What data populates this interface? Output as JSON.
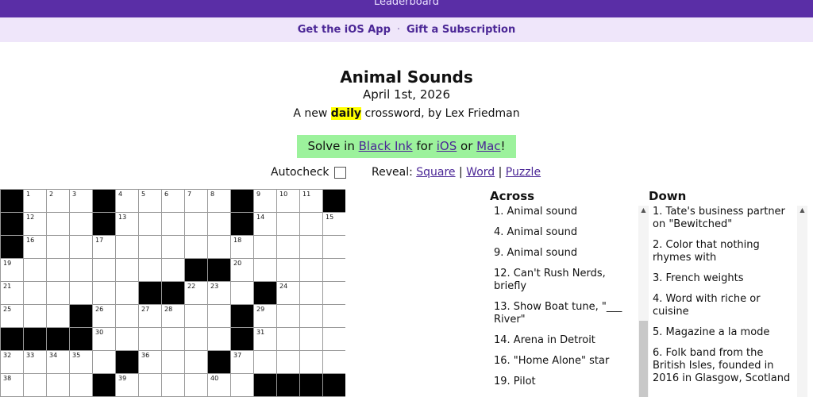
{
  "header": {
    "leaderboard_label": "Leaderboard"
  },
  "promo": {
    "ios_app": "Get the iOS App",
    "separator": "·",
    "gift": "Gift a Subscription"
  },
  "puzzle": {
    "title": "Animal Sounds",
    "date": "April 1st, 2026",
    "byline_pre": "A new ",
    "byline_highlight": "daily",
    "byline_post": " crossword, by Lex Friedman"
  },
  "solve_banner": {
    "prefix": "Solve in ",
    "app_link": "Black Ink",
    "mid": " for ",
    "ios_link": "iOS",
    "or": " or ",
    "mac_link": "Mac",
    "suffix": "!"
  },
  "controls": {
    "autocheck_label": "Autocheck",
    "reveal_label": "Reveal:",
    "square": "Square",
    "word": "Word",
    "puzzle": "Puzzle",
    "sep": "|"
  },
  "grid_rows": [
    [
      "#",
      "1",
      "2",
      "3",
      "#",
      "4",
      "5",
      "6",
      "7",
      "8",
      "#",
      "9",
      "10",
      "11",
      "#"
    ],
    [
      "#",
      "12",
      "",
      "",
      "#",
      "13",
      "",
      "",
      "",
      "",
      "#",
      "14",
      "",
      "",
      "15"
    ],
    [
      "#",
      "16",
      "",
      "",
      "17",
      "",
      "",
      "",
      "",
      "",
      "18",
      "",
      "",
      "",
      ""
    ],
    [
      "19",
      "",
      "",
      "",
      "",
      "",
      "",
      "",
      "#",
      "#",
      "20",
      "",
      "",
      "",
      ""
    ],
    [
      "21",
      "",
      "",
      "",
      "",
      "",
      "#",
      "#",
      "22",
      "23",
      "",
      "#",
      "24",
      "",
      ""
    ],
    [
      "25",
      "",
      "",
      "#",
      "26",
      "",
      "27",
      "28",
      "",
      "",
      "#",
      "29",
      "",
      "",
      ""
    ],
    [
      "#",
      "#",
      "#",
      "#",
      "30",
      "",
      "",
      "",
      "",
      "",
      "#",
      "31",
      "",
      "",
      ""
    ],
    [
      "32",
      "33",
      "34",
      "35",
      "",
      "#",
      "36",
      "",
      "",
      "#",
      "37",
      "",
      "",
      "",
      ""
    ],
    [
      "38",
      "",
      "",
      "",
      "#",
      "39",
      "",
      "",
      "",
      "40",
      "",
      "#",
      "#",
      "#",
      "#"
    ]
  ],
  "across": {
    "title": "Across",
    "clues": [
      "1. Animal sound",
      "4. Animal sound",
      "9. Animal sound",
      "12. Can't Rush Nerds, briefly",
      "13. Show Boat tune, \"___ River\"",
      "14. Arena in Detroit",
      "16. \"Home Alone\" star",
      "19. Pilot"
    ]
  },
  "down": {
    "title": "Down",
    "clues": [
      "1. Tate's business partner on \"Bewitched\"",
      "2. Color that nothing rhymes with",
      "3. French weights",
      "4. Word with riche or cuisine",
      "5. Magazine a la mode",
      "6. Folk band from the British Isles, founded in 2016 in Glasgow, Scotland"
    ]
  }
}
